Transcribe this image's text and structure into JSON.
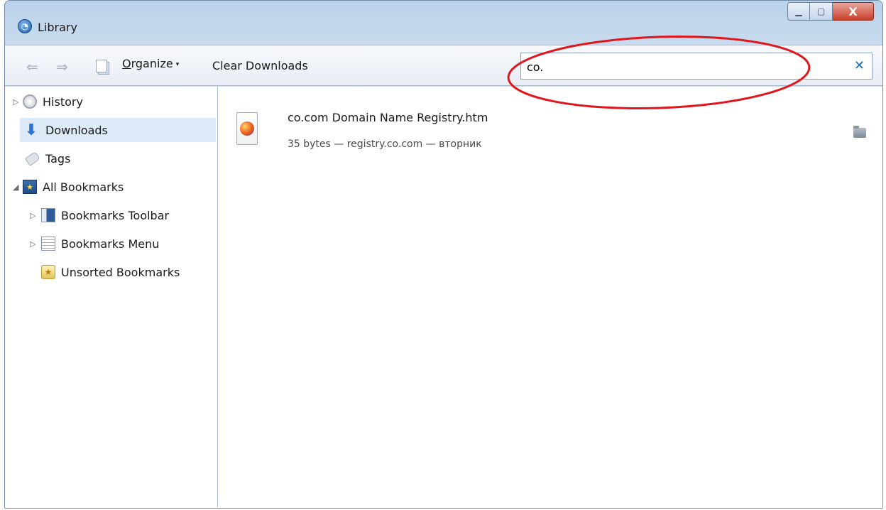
{
  "window": {
    "title": "Library",
    "icon": "firefox-library-icon",
    "controls": {
      "minimize_icon": "minimize-icon",
      "maximize_icon": "maximize-icon",
      "close_label": "X"
    }
  },
  "toolbar": {
    "back_icon": "back-arrow-icon",
    "forward_icon": "forward-arrow-icon",
    "back_glyph": "⇐",
    "forward_glyph": "⇒",
    "organize_label_underlined": "O",
    "organize_label_rest": "rganize",
    "organize_caret": "▾",
    "clear_downloads_label": "Clear Downloads",
    "search": {
      "value": "co.",
      "clear_glyph": "✕"
    }
  },
  "sidebar": {
    "items": [
      {
        "label": "History",
        "icon": "history-clock-icon",
        "twisty": "▷",
        "selected": false
      },
      {
        "label": "Downloads",
        "icon": "download-arrow-icon",
        "twisty": "",
        "selected": true
      },
      {
        "label": "Tags",
        "icon": "tag-icon",
        "twisty": "",
        "selected": false
      },
      {
        "label": "All Bookmarks",
        "icon": "all-bookmarks-icon",
        "twisty": "◢",
        "selected": false
      },
      {
        "label": "Bookmarks Toolbar",
        "icon": "bookmarks-toolbar-icon",
        "twisty": "▷",
        "selected": false
      },
      {
        "label": "Bookmarks Menu",
        "icon": "bookmarks-menu-icon",
        "twisty": "▷",
        "selected": false
      },
      {
        "label": "Unsorted Bookmarks",
        "icon": "unsorted-bookmarks-icon",
        "twisty": "",
        "selected": false
      }
    ]
  },
  "downloads": [
    {
      "name": "co.com Domain Name Registry.htm",
      "meta": "35 bytes — registry.co.com — вторник",
      "file_icon": "firefox-htm-file-icon",
      "action_icon": "open-folder-icon"
    }
  ],
  "annotation": {
    "color": "#e0161c",
    "shape": "ellipse"
  },
  "colors": {
    "accent": "#1f66b5",
    "selection": "#dce9f6",
    "close_button": "#c9402c"
  }
}
